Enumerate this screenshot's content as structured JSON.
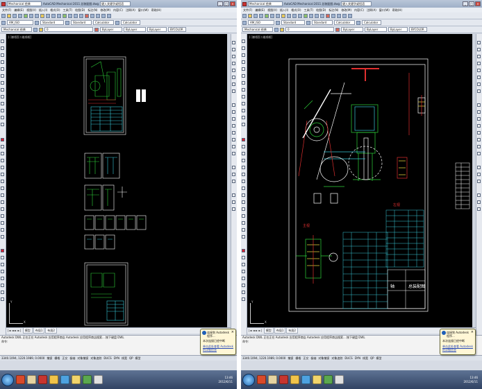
{
  "window_left": {
    "search_value": "键入关键字或短语",
    "workspace": "Mechanical 经典",
    "title": "AutoCAD Mechanical 2011  总装配图.dwg",
    "window_buttons": [
      "_",
      "□",
      "×"
    ],
    "menus": [
      "文件(F)",
      "编辑(E)",
      "视图(V)",
      "插入(I)",
      "格式(O)",
      "工具(T)",
      "绘图(D)",
      "标注(N)",
      "修改(M)",
      "内容(C)",
      "注释(A)",
      "窗口(W)",
      "帮助(H)"
    ],
    "toolbar2": {
      "style_dropdown": "AM_ISO",
      "dim_style": "Standard",
      "table_style": "Standard",
      "calculator": "Calculator",
      "calc2": "Calculator"
    },
    "toolbar3": {
      "workspace_dropdown": "Mechanical 经典",
      "layer_dropdown": "0",
      "color": "ByLayer",
      "linetype": "ByLayer",
      "lineweight": "ByLayer",
      "plot_style": "BYCOLOR"
    },
    "viewport_label": "[-]俯视][二维线框]",
    "tabs": [
      "模型",
      "布局1",
      "布局2"
    ],
    "ucs": {
      "y": "Y",
      "x": "X"
    },
    "command_lines": [
      "Autodesk DWL   正在正在 Autodesk 应用程序商店  Autodesk  应用程序商店搜索...  按下键盘 DWL",
      "命令:"
    ],
    "status": [
      "3340.1094, 1220.1989, 0.0000",
      "捕捉",
      "栅格",
      "正交",
      "极轴",
      "对象捕捉",
      "对象追踪",
      "DUCS",
      "DYN",
      "线宽",
      "QP",
      "模型"
    ],
    "balloon": {
      "title": "连接到 Autodesk 程序...",
      "body": "本次连接已经中断",
      "link": "单击此处查看 Autodesk 的详细信息"
    }
  },
  "window_right": {
    "search_value": "键入关键字或短语",
    "workspace": "Mechanical 经典",
    "title": "AutoCAD Mechanical 2011  总装配图.dwg",
    "window_buttons": [
      "_",
      "□",
      "×"
    ],
    "menus": [
      "文件(F)",
      "编辑(E)",
      "视图(V)",
      "插入(I)",
      "格式(O)",
      "工具(T)",
      "绘图(D)",
      "标注(N)",
      "修改(M)",
      "内容(C)",
      "注释(A)",
      "窗口(W)",
      "帮助(H)"
    ],
    "toolbar2": {
      "style_dropdown": "AM_ISO",
      "dim_style": "Standard",
      "table_style": "Standard",
      "calculator": "Calculator",
      "calc2": "Calculator"
    },
    "toolbar3": {
      "workspace_dropdown": "Mechanical 经典",
      "layer_dropdown": "0",
      "color": "ByLayer",
      "linetype": "ByLayer",
      "lineweight": "ByLayer",
      "plot_style": "BYCOLOR"
    },
    "viewport_label": "[-]俯视][二维线框]",
    "tabs": [
      "模型",
      "布局1",
      "布局2"
    ],
    "ucs": {
      "y": "Y",
      "x": "X"
    },
    "command_lines": [
      "Autodesk DWL   正在正在 Autodesk 应用程序商店  Autodesk  应用程序商店搜索...  按下键盘 DWL",
      "命令:"
    ],
    "status": [
      "3340.1094, 1220.1989, 0.0000",
      "捕捉",
      "栅格",
      "正交",
      "极轴",
      "对象捕捉",
      "对象追踪",
      "DUCS",
      "DYN",
      "线宽",
      "QP",
      "模型"
    ],
    "balloon": {
      "title": "连接到 Autodesk 程序...",
      "body": "本次连接已经中断",
      "link": "单击此处查看 Autodesk 的详细信息"
    }
  },
  "drawing_right": {
    "title_block_name": "总装配图",
    "title_block_part": "轴",
    "label_main": "主视",
    "label_side": "左视"
  },
  "taskbar": {
    "time": "13:46",
    "date": "2012/6/11"
  },
  "colors": {
    "canvas": "#000000",
    "drawing_green": "#2fd43a",
    "drawing_cyan": "#38c8d8",
    "drawing_white": "#ffffff",
    "drawing_red": "#e03030",
    "drawing_yellow": "#e8d23a"
  }
}
